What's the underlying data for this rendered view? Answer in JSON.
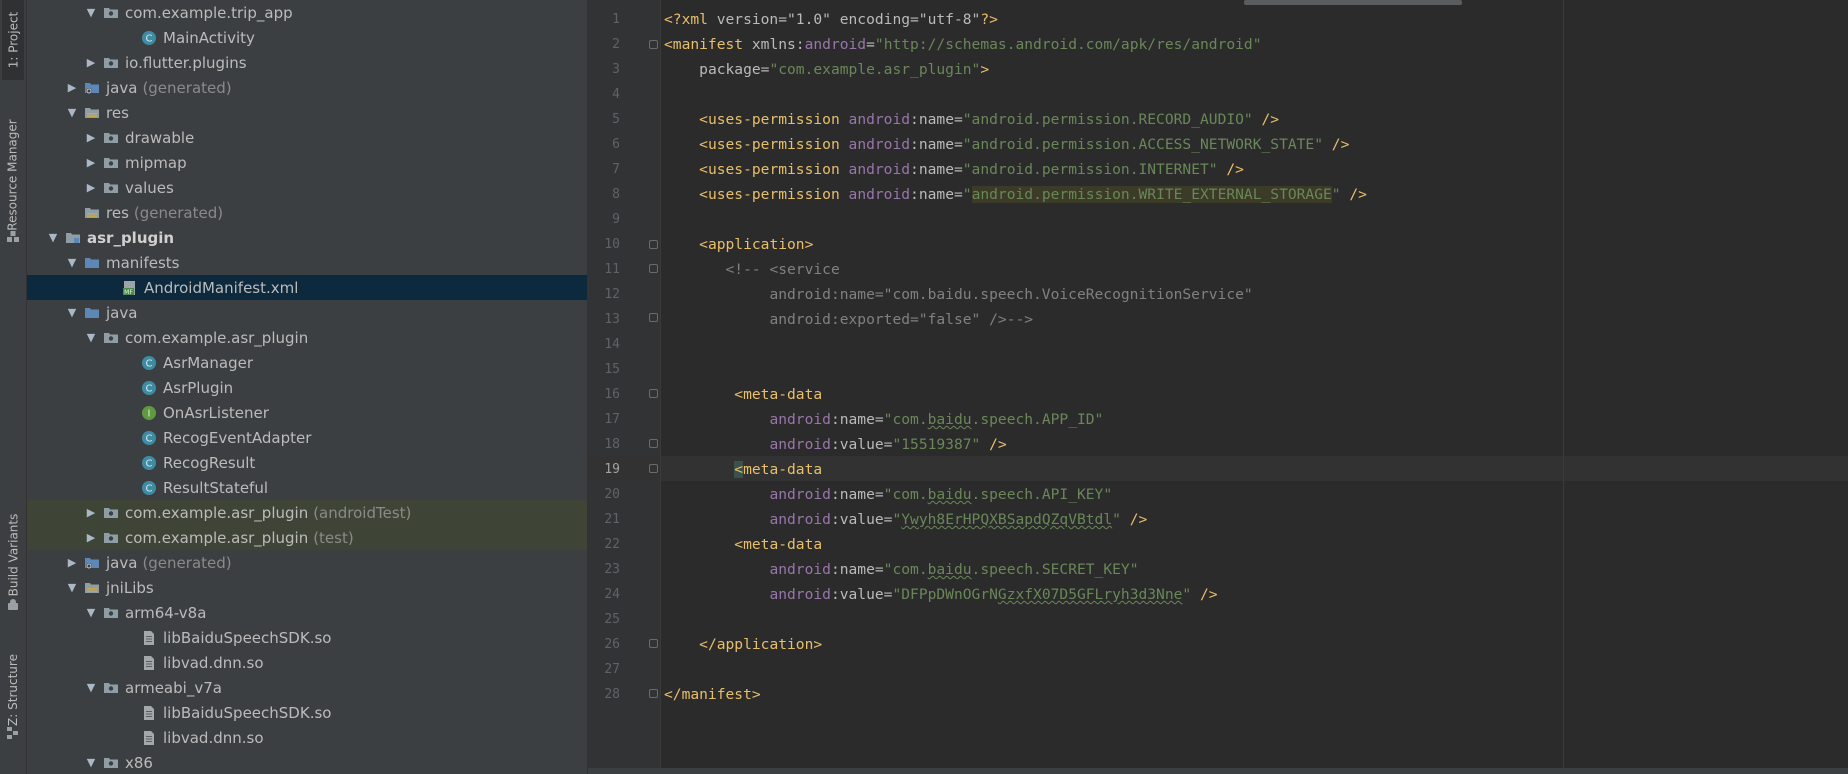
{
  "sidebar": {
    "tabs": [
      {
        "label": "1: Project"
      },
      {
        "label": "Resource Manager"
      },
      {
        "label": "Build Variants"
      },
      {
        "label": "Z: Structure"
      }
    ]
  },
  "tree": [
    {
      "label": "com.example.trip_app",
      "suffix": "",
      "icon": "package-icon",
      "arrow": "expanded"
    },
    {
      "label": "MainActivity",
      "suffix": "",
      "icon": "class-icon",
      "arrow": "none"
    },
    {
      "label": "io.flutter.plugins",
      "suffix": "",
      "icon": "package-icon",
      "arrow": "collapsed"
    },
    {
      "label": "java",
      "suffix": "(generated)",
      "icon": "generated-folder-icon",
      "arrow": "collapsed"
    },
    {
      "label": "res",
      "suffix": "",
      "icon": "resource-folder-icon",
      "arrow": "expanded"
    },
    {
      "label": "drawable",
      "suffix": "",
      "icon": "package-icon",
      "arrow": "collapsed"
    },
    {
      "label": "mipmap",
      "suffix": "",
      "icon": "package-icon",
      "arrow": "collapsed"
    },
    {
      "label": "values",
      "suffix": "",
      "icon": "package-icon",
      "arrow": "collapsed"
    },
    {
      "label": "res",
      "suffix": "(generated)",
      "icon": "resource-folder-icon",
      "arrow": "none"
    },
    {
      "label": "asr_plugin",
      "suffix": "",
      "icon": "module-icon",
      "arrow": "expanded"
    },
    {
      "label": "manifests",
      "suffix": "",
      "icon": "folder-icon",
      "arrow": "expanded"
    },
    {
      "label": "AndroidManifest.xml",
      "suffix": "",
      "icon": "manifest-file-icon",
      "arrow": "none"
    },
    {
      "label": "java",
      "suffix": "",
      "icon": "source-folder-icon",
      "arrow": "expanded"
    },
    {
      "label": "com.example.asr_plugin",
      "suffix": "",
      "icon": "package-icon",
      "arrow": "expanded"
    },
    {
      "label": "AsrManager",
      "suffix": "",
      "icon": "class-icon",
      "arrow": "none"
    },
    {
      "label": "AsrPlugin",
      "suffix": "",
      "icon": "class-icon",
      "arrow": "none"
    },
    {
      "label": "OnAsrListener",
      "suffix": "",
      "icon": "interface-icon",
      "arrow": "none"
    },
    {
      "label": "RecogEventAdapter",
      "suffix": "",
      "icon": "class-icon",
      "arrow": "none"
    },
    {
      "label": "RecogResult",
      "suffix": "",
      "icon": "class-icon",
      "arrow": "none"
    },
    {
      "label": "ResultStateful",
      "suffix": "",
      "icon": "class-icon",
      "arrow": "none"
    },
    {
      "label": "com.example.asr_plugin",
      "suffix": "(androidTest)",
      "icon": "package-icon",
      "arrow": "collapsed"
    },
    {
      "label": "com.example.asr_plugin",
      "suffix": "(test)",
      "icon": "package-icon",
      "arrow": "collapsed"
    },
    {
      "label": "java",
      "suffix": "(generated)",
      "icon": "generated-folder-icon",
      "arrow": "collapsed"
    },
    {
      "label": "jniLibs",
      "suffix": "",
      "icon": "resource-folder-icon",
      "arrow": "expanded"
    },
    {
      "label": "arm64-v8a",
      "suffix": "",
      "icon": "package-icon",
      "arrow": "expanded"
    },
    {
      "label": "libBaiduSpeechSDK.so",
      "suffix": "",
      "icon": "file-icon",
      "arrow": "none"
    },
    {
      "label": "libvad.dnn.so",
      "suffix": "",
      "icon": "file-icon",
      "arrow": "none"
    },
    {
      "label": "armeabi_v7a",
      "suffix": "",
      "icon": "package-icon",
      "arrow": "expanded"
    },
    {
      "label": "libBaiduSpeechSDK.so",
      "suffix": "",
      "icon": "file-icon",
      "arrow": "none"
    },
    {
      "label": "libvad.dnn.so",
      "suffix": "",
      "icon": "file-icon",
      "arrow": "none"
    },
    {
      "label": "x86",
      "suffix": "",
      "icon": "package-icon",
      "arrow": "expanded"
    }
  ],
  "editor": {
    "current_line": 19,
    "lines": [
      {
        "num": "1"
      },
      {
        "num": "2"
      },
      {
        "num": "3"
      },
      {
        "num": "4"
      },
      {
        "num": "5"
      },
      {
        "num": "6"
      },
      {
        "num": "7"
      },
      {
        "num": "8"
      },
      {
        "num": "9"
      },
      {
        "num": "10"
      },
      {
        "num": "11"
      },
      {
        "num": "12"
      },
      {
        "num": "13"
      },
      {
        "num": "14"
      },
      {
        "num": "15"
      },
      {
        "num": "16"
      },
      {
        "num": "17"
      },
      {
        "num": "18"
      },
      {
        "num": "19"
      },
      {
        "num": "20"
      },
      {
        "num": "21"
      },
      {
        "num": "22"
      },
      {
        "num": "23"
      },
      {
        "num": "24"
      },
      {
        "num": "25"
      },
      {
        "num": "26"
      },
      {
        "num": "27"
      },
      {
        "num": "28"
      }
    ],
    "tokens": {
      "xml_decl_open": "<?xml ",
      "xml_decl_attrs": "version=\"1.0\" encoding=\"utf-8\"",
      "xml_decl_close": "?>",
      "manifest_open": "<manifest ",
      "xmlns_prefix": "xmlns:",
      "xmlns_android": "android",
      "xmlns_eq": "=",
      "xmlns_value": "\"http://schemas.android.com/apk/res/android\"",
      "package_attr": "package=",
      "package_value": "\"com.example.asr_plugin\"",
      "gt": ">",
      "uses_permission": "<uses-permission ",
      "android_ns": "android",
      "name_attr": ":name=",
      "value_attr": ":value=",
      "exported_attr": ":exported=",
      "selfclose": " />",
      "perm1": "\"android.permission.RECORD_AUDIO\"",
      "perm2": "\"android.permission.ACCESS_NETWORK_STATE\"",
      "perm3": "\"android.permission.INTERNET\"",
      "perm4_q1": "\"",
      "perm4": "android.permission.WRITE_EXTERNAL_STORAGE",
      "perm4_q2": "\"",
      "application_open": "<application>",
      "comment1": "<!-- <service",
      "comment2": "android:name=\"com.baidu.speech.VoiceRecognitionService\"",
      "comment3": "android:exported=\"false\" />-->",
      "meta_lt": "<",
      "meta_data": "meta-data",
      "app_id_name_a": "\"com.",
      "baidu": "baidu",
      "app_id_name_b": ".speech.APP_ID\"",
      "app_id_value": "\"15519387\"",
      "api_key_name_b": ".speech.API_KEY\"",
      "api_key_value_a": "\"",
      "api_key_value_sq": "Ywyh8ErHPQXBSapdQZqVBtdl",
      "api_key_value_b": "\"",
      "secret_name_b": ".speech.SECRET_KEY\"",
      "secret_value_a": "\"DFPpDWnOGrN",
      "secret_value_sq": "GzxfX07D5GFLryh3d3Nne",
      "secret_value_b": "\"",
      "application_close": "</application>",
      "manifest_close": "</manifest>"
    }
  }
}
